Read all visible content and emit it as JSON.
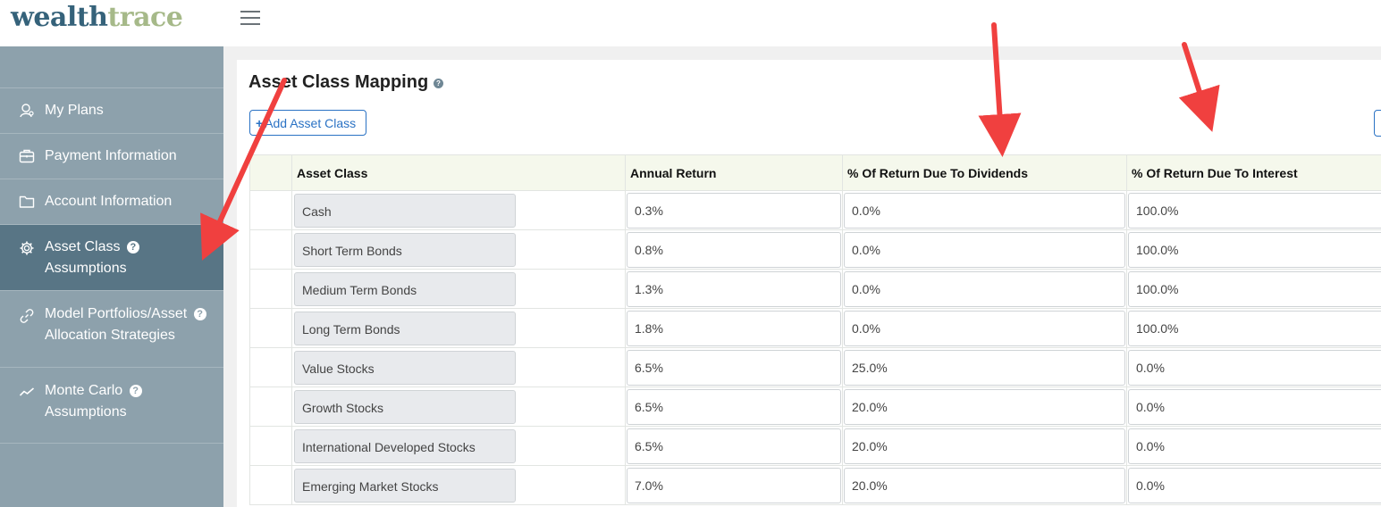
{
  "brand": {
    "logo_part1": "wealth",
    "logo_part2": "trace"
  },
  "sidebar": {
    "items": [
      {
        "label": "My Plans",
        "icon": "user-icon",
        "help": false,
        "active": false
      },
      {
        "label": "Payment Information",
        "icon": "briefcase-icon",
        "help": false,
        "active": false
      },
      {
        "label": "Account Information",
        "icon": "folder-icon",
        "help": false,
        "active": false
      },
      {
        "label_line1": "Asset Class",
        "label_line2": "Assumptions",
        "icon": "gear-icon",
        "help": true,
        "active": true
      },
      {
        "label_line1": "Model Portfolios/Asset",
        "label_line2": "Allocation Strategies",
        "icon": "link-icon",
        "help": true,
        "active": false
      },
      {
        "label_line1": "Monte Carlo",
        "label_line2": "Assumptions",
        "icon": "trend-icon",
        "help": true,
        "active": false
      }
    ],
    "help_glyph": "?"
  },
  "main": {
    "title": "Asset Class Mapping",
    "help_glyph": "?",
    "add_button": {
      "plus": "+",
      "label": "Add Asset Class"
    }
  },
  "table": {
    "headers": [
      "Asset Class",
      "Annual Return",
      "% Of Return Due To Dividends",
      "% Of Return Due To Interest"
    ],
    "rows": [
      {
        "name": "Cash",
        "annual": "0.3%",
        "dividends": "0.0%",
        "interest": "100.0%"
      },
      {
        "name": "Short Term Bonds",
        "annual": "0.8%",
        "dividends": "0.0%",
        "interest": "100.0%"
      },
      {
        "name": "Medium Term Bonds",
        "annual": "1.3%",
        "dividends": "0.0%",
        "interest": "100.0%"
      },
      {
        "name": "Long Term Bonds",
        "annual": "1.8%",
        "dividends": "0.0%",
        "interest": "100.0%"
      },
      {
        "name": "Value Stocks",
        "annual": "6.5%",
        "dividends": "25.0%",
        "interest": "0.0%"
      },
      {
        "name": "Growth Stocks",
        "annual": "6.5%",
        "dividends": "20.0%",
        "interest": "0.0%"
      },
      {
        "name": "International Developed Stocks",
        "annual": "6.5%",
        "dividends": "20.0%",
        "interest": "0.0%"
      },
      {
        "name": "Emerging Market Stocks",
        "annual": "7.0%",
        "dividends": "20.0%",
        "interest": "0.0%"
      }
    ]
  },
  "colors": {
    "sidebar_bg": "#8da1ac",
    "sidebar_active": "#587585",
    "accent_blue": "#2a72c4",
    "annotation_arrow": "#f0403f",
    "header_bg": "#f5f8ec"
  }
}
